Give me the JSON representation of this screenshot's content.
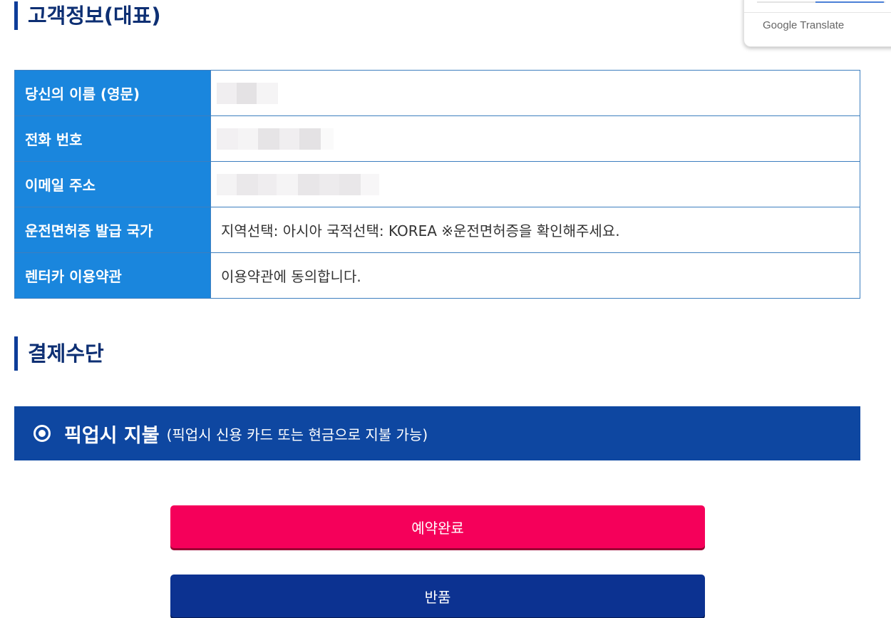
{
  "headings": {
    "customer": "고객정보(대표)",
    "payment": "결제수단"
  },
  "customer_table": {
    "rows": [
      {
        "label": "당신의 이름 (영문)",
        "value": ""
      },
      {
        "label": "전화 번호",
        "value": ""
      },
      {
        "label": "이메일 주소",
        "value": ""
      },
      {
        "label": "운전면허증 발급 국가",
        "value": "지역선택: 아시아 국적선택: KOREA ※운전면허증을 확인해주세요."
      },
      {
        "label": "렌터카 이용약관",
        "value": "이용약관에 동의합니다."
      }
    ]
  },
  "payment": {
    "option_label": "픽업시 지불",
    "option_note": "(픽업시 신용 카드 또는 현금으로 지불 가능)",
    "icon": "radio-selected-icon"
  },
  "buttons": {
    "complete": "예약완료",
    "return": "반품"
  },
  "google_translate": {
    "label": "Google Translate"
  },
  "colors": {
    "heading": "#0d2f73",
    "label_bg": "#1a86dd",
    "payment_bar": "#0e47a1",
    "complete_button": "#f5005a",
    "return_button": "#0c3291"
  }
}
